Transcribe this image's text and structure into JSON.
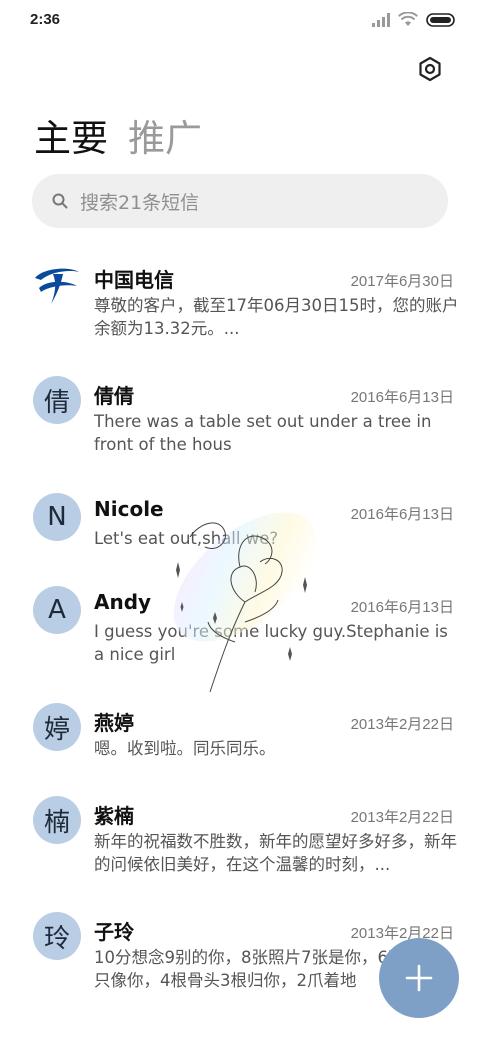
{
  "status_bar": {
    "time": "2:36",
    "icons": [
      "signal-icon",
      "wifi-icon",
      "battery-icon"
    ]
  },
  "header": {
    "settings_icon": "gear-icon"
  },
  "tabs": [
    {
      "label": "主要",
      "active": true
    },
    {
      "label": "推广",
      "active": false
    }
  ],
  "search": {
    "placeholder": "搜索21条短信"
  },
  "conversations": [
    {
      "name": "中国电信",
      "date": "2017年6月30日",
      "preview": "尊敬的客户，截至17年06月30日15时，您的账户余额为13.32元。...",
      "avatar": "",
      "avatar_type": "logo"
    },
    {
      "name": "倩倩",
      "date": "2016年6月13日",
      "preview": "There was a table set out under a tree in front of the hous",
      "avatar": "倩",
      "avatar_type": "letter"
    },
    {
      "name": "Nicole",
      "date": "2016年6月13日",
      "preview": "Let's eat out,shall we?",
      "avatar": "N",
      "avatar_type": "letter"
    },
    {
      "name": "Andy",
      "date": "2016年6月13日",
      "preview": "I guess you're some lucky guy.Stephanie is a nice girl",
      "avatar": "A",
      "avatar_type": "letter"
    },
    {
      "name": "燕婷",
      "date": "2013年2月22日",
      "preview": "嗯。收到啦。同乐同乐。",
      "avatar": "婷",
      "avatar_type": "letter"
    },
    {
      "name": "紫楠",
      "date": "2013年2月22日",
      "preview": "新年的祝福数不胜数，新年的愿望好多好多，新年的问候依旧美好，在这个温馨的时刻，...",
      "avatar": "楠",
      "avatar_type": "letter"
    },
    {
      "name": "子玲",
      "date": "2013年2月22日",
      "preview": "10分想念9别的你，8张照片7张是你，6次梦里5只像你，4根骨头3根归你，2爪着地",
      "avatar": "玲",
      "avatar_type": "letter"
    }
  ],
  "fab": {
    "icon": "plus-icon"
  },
  "colors": {
    "avatar_bg": "#b9cde4",
    "fab_bg": "#7ea0c6",
    "brand_blue": "#0a4a9c",
    "search_bg": "#efefef"
  }
}
